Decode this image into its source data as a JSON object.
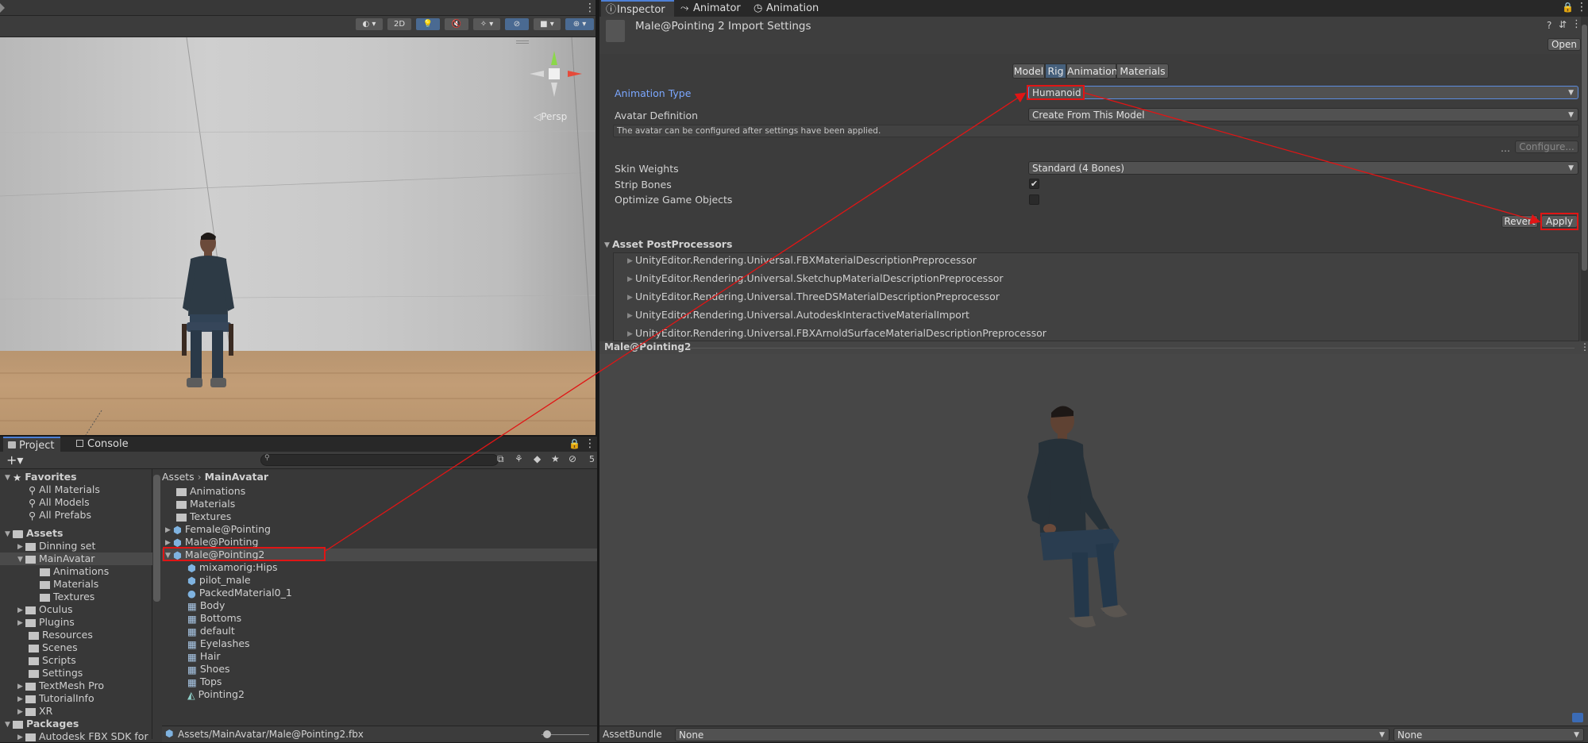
{
  "scene": {
    "toolbar": {
      "mode_2d": "2D"
    },
    "gizmo_label": "◁Persp"
  },
  "project": {
    "tabs": [
      {
        "label": "Project"
      },
      {
        "label": "Console"
      }
    ],
    "hidden_count": "5",
    "favorites": {
      "header": "Favorites",
      "items": [
        "All Materials",
        "All Models",
        "All Prefabs"
      ]
    },
    "assets_tree": {
      "header": "Assets",
      "items": [
        "Dinning set",
        "MainAvatar",
        "Animations",
        "Materials",
        "Textures",
        "Oculus",
        "Plugins",
        "Resources",
        "Scenes",
        "Scripts",
        "Settings",
        "TextMesh Pro",
        "TutorialInfo",
        "XR"
      ]
    },
    "packages": {
      "header": "Packages",
      "items": [
        "Autodesk FBX SDK for Ur"
      ]
    },
    "breadcrumb": {
      "root": "Assets",
      "sep": "›",
      "current": "MainAvatar"
    },
    "list_items": [
      "Animations",
      "Materials",
      "Textures",
      "Female@Pointing",
      "Male@Pointing",
      "Male@Pointing2",
      "mixamorig:Hips",
      "pilot_male",
      "PackedMaterial0_1",
      "Body",
      "Bottoms",
      "default",
      "Eyelashes",
      "Hair",
      "Shoes",
      "Tops",
      "Pointing2"
    ],
    "footer_path": "Assets/MainAvatar/Male@Pointing2.fbx"
  },
  "inspector": {
    "tabs": [
      {
        "label": "Inspector"
      },
      {
        "label": "Animator"
      },
      {
        "label": "Animation"
      }
    ],
    "title": "Male@Pointing 2 Import Settings",
    "open_label": "Open",
    "subtabs": [
      "Model",
      "Rig",
      "Animation",
      "Materials"
    ],
    "animation_type": {
      "label": "Animation Type",
      "value": "Humanoid"
    },
    "avatar_definition": {
      "label": "Avatar Definition",
      "value": "Create From This Model"
    },
    "hint": "The avatar can be configured after settings have been applied.",
    "ellipsis": "...",
    "configure_label": "Configure...",
    "skin_weights": {
      "label": "Skin Weights",
      "value": "Standard (4 Bones)"
    },
    "strip_bones": {
      "label": "Strip Bones",
      "checked": true,
      "mark": "✔"
    },
    "optimize_game_objects": {
      "label": "Optimize Game Objects",
      "checked": false
    },
    "revert_label": "Revert",
    "apply_label": "Apply",
    "postprocessors": {
      "header": "Asset PostProcessors",
      "items": [
        "UnityEditor.Rendering.Universal.FBXMaterialDescriptionPreprocessor",
        "UnityEditor.Rendering.Universal.SketchupMaterialDescriptionPreprocessor",
        "UnityEditor.Rendering.Universal.ThreeDSMaterialDescriptionPreprocessor",
        "UnityEditor.Rendering.Universal.AutodeskInteractiveMaterialImport",
        "UnityEditor.Rendering.Universal.FBXArnoldSurfaceMaterialDescriptionPreprocessor"
      ]
    }
  },
  "preview": {
    "title": "Male@Pointing2"
  },
  "assetbundle": {
    "label": "AssetBundle",
    "name": "None",
    "variant": "None"
  },
  "colors": {
    "accent": "#4d7fd6",
    "annotation": "#e01515",
    "label_blue": "#7ba7ff"
  }
}
